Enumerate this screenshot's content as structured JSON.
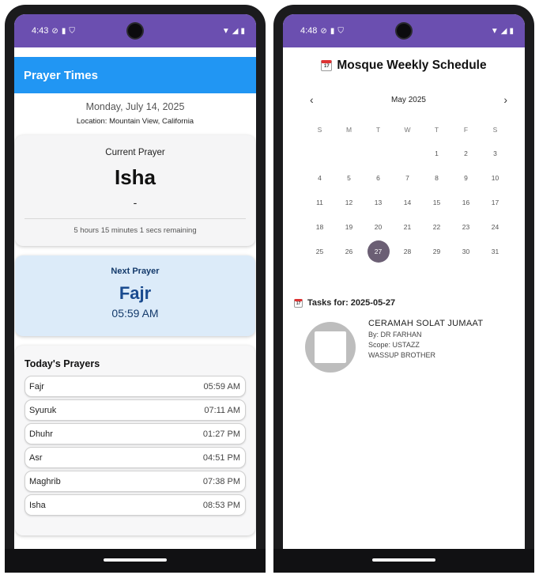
{
  "left": {
    "status": {
      "time": "4:43"
    },
    "appbar_title": "Prayer Times",
    "date": "Monday, July 14, 2025",
    "location": "Location: Mountain View, California",
    "current": {
      "label": "Current Prayer",
      "name": "Isha",
      "dash": "-",
      "remaining": "5 hours 15 minutes 1 secs remaining"
    },
    "next": {
      "label": "Next Prayer",
      "name": "Fajr",
      "time": "05:59 AM"
    },
    "today": {
      "title": "Today's Prayers",
      "prayers": [
        {
          "name": "Fajr",
          "time": "05:59 AM"
        },
        {
          "name": "Syuruk",
          "time": "07:11 AM"
        },
        {
          "name": "Dhuhr",
          "time": "01:27 PM"
        },
        {
          "name": "Asr",
          "time": "04:51 PM"
        },
        {
          "name": "Maghrib",
          "time": "07:38 PM"
        },
        {
          "name": "Isha",
          "time": "08:53 PM"
        }
      ]
    }
  },
  "right": {
    "status": {
      "time": "4:48"
    },
    "title": "Mosque Weekly Schedule",
    "calendar": {
      "month_label": "May 2025",
      "prev": "‹",
      "next": "›",
      "weekdays": [
        "S",
        "M",
        "T",
        "W",
        "T",
        "F",
        "S"
      ],
      "leading_blanks": 4,
      "days": [
        "1",
        "2",
        "3",
        "4",
        "5",
        "6",
        "7",
        "8",
        "9",
        "10",
        "11",
        "12",
        "13",
        "14",
        "15",
        "16",
        "17",
        "18",
        "19",
        "20",
        "21",
        "22",
        "23",
        "24",
        "25",
        "26",
        "27",
        "28",
        "29",
        "30",
        "31"
      ],
      "selected": "27"
    },
    "tasks_label": "Tasks for: 2025-05-27",
    "task": {
      "title": "CERAMAH SOLAT JUMAAT",
      "by": "By: DR FARHAN",
      "scope": "Scope: USTAZZ",
      "note": "WASSUP BROTHER"
    }
  },
  "icons": {
    "status_left": [
      "location-off-icon",
      "sim-card-icon",
      "shield-icon"
    ],
    "status_right": [
      "wifi-icon",
      "signal-icon",
      "battery-icon"
    ],
    "calendar": "calendar-icon"
  }
}
